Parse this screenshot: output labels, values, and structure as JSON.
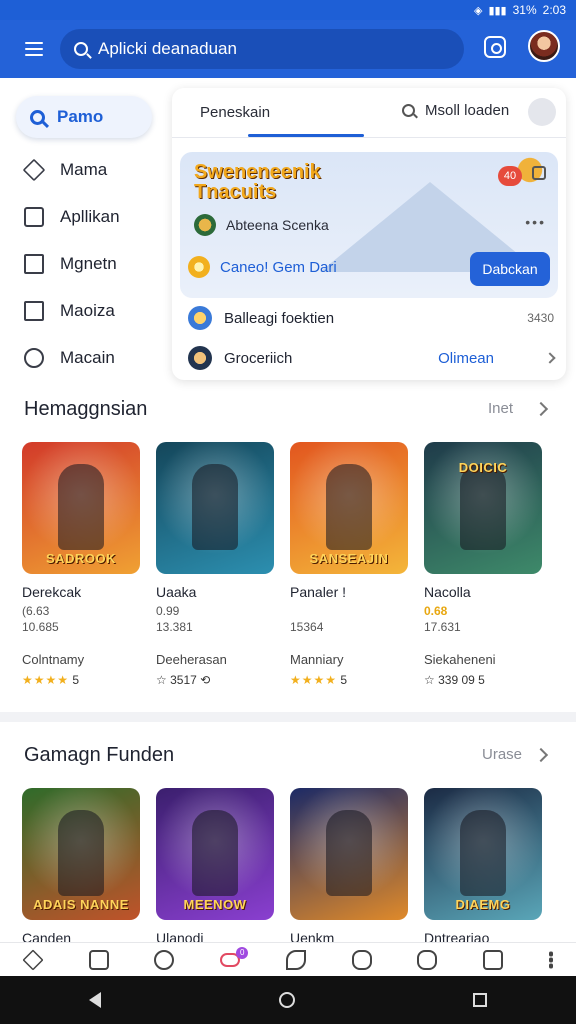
{
  "status": {
    "battery": "31%",
    "time": "2:03"
  },
  "header": {
    "search_text": "Aplicki deanaduan"
  },
  "leftnav": {
    "search_label": "Pamo",
    "items": [
      {
        "label": "Mama",
        "icon": "home-icon"
      },
      {
        "label": "Apllikan",
        "icon": "app-icon"
      },
      {
        "label": "Mgnetn",
        "icon": "grid-icon"
      },
      {
        "label": "Maoiza",
        "icon": "box-icon"
      },
      {
        "label": "Macain",
        "icon": "circle-icon"
      }
    ]
  },
  "panel": {
    "tab1": "Peneskain",
    "tab2": "Msoll loaden",
    "hero": {
      "title_line1": "Sweneneenik",
      "title_line2": "Tnacuits",
      "badge": "40",
      "sub": "Abteena Scenka",
      "more": "•••",
      "row": "Caneo! Gem Dari",
      "button": "Dabckan"
    },
    "rows": [
      {
        "label": "Balleagi foektien",
        "value": "3430"
      },
      {
        "label": "Groceriich",
        "link": "Olimean"
      }
    ]
  },
  "section1": {
    "title": "Hemaggnsian",
    "more": "Inet",
    "cards": [
      {
        "name": "Derekcak",
        "line1": "(6.63",
        "line2": "10.685",
        "category": "Colntnamy",
        "rating": "★★★★",
        "rating_extra": "5",
        "logo": "SADROOK",
        "c1": "#d23a2a",
        "c2": "#f0a133"
      },
      {
        "name": "Uaaka",
        "line1": "0.99",
        "line2": "13.381",
        "category": "Deeherasan",
        "rating": "☆ 3517",
        "rating_extra": "⟲",
        "logo": "",
        "c1": "#14465a",
        "c2": "#2c8fb0"
      },
      {
        "name": "Panaler !",
        "line1": "",
        "line2": "15364",
        "category": "Manniary",
        "rating": "★★★★",
        "rating_extra": "5",
        "logo": "SANSEAJIN",
        "c1": "#e2561f",
        "c2": "#f4b63a"
      },
      {
        "name": "Nacolla",
        "line1": "0.68",
        "line2": "17.631",
        "category": "Siekaheneni",
        "rating": "☆ 339 09",
        "rating_extra": "5",
        "logo": "DOICIC",
        "c1": "#1f3b4a",
        "c2": "#3e8a6a",
        "highlight": true
      }
    ]
  },
  "section2": {
    "title": "Gamagn Funden",
    "more": "Urase",
    "cards": [
      {
        "name": "Canden",
        "logo": "ADAIS NANNE",
        "c1": "#2f6b2a",
        "c2": "#c0532a"
      },
      {
        "name": "Ulanodi",
        "logo": "MEENOW",
        "c1": "#3b1f6e",
        "c2": "#8a3fd0"
      },
      {
        "name": "Uenkm",
        "logo": "",
        "c1": "#1c2a66",
        "c2": "#e08a2a"
      },
      {
        "name": "Dntreariao",
        "logo": "DIAEMG",
        "c1": "#1b2a44",
        "c2": "#5aa6b8"
      }
    ]
  },
  "bottom_tabs": [
    "home",
    "square",
    "circle",
    "game",
    "leaf",
    "star",
    "page",
    "more"
  ],
  "game_badge": "0"
}
